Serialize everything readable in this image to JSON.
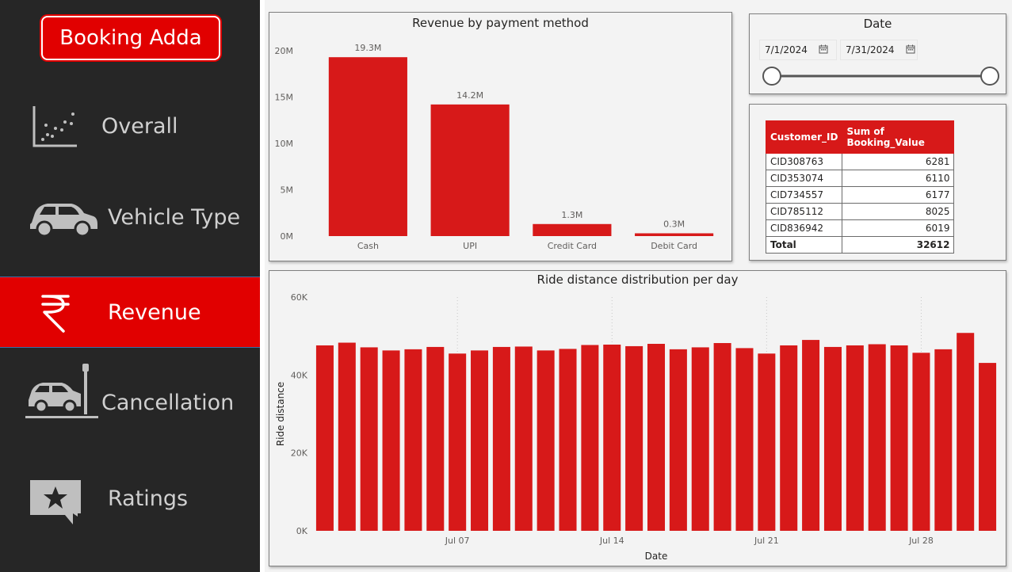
{
  "app": {
    "logo": "Booking Adda"
  },
  "nav": [
    {
      "label": "Overall",
      "icon": "scatter-chart-icon"
    },
    {
      "label": "Vehicle Type",
      "icon": "car-icon"
    },
    {
      "label": "Revenue",
      "icon": "rupee-icon",
      "active": true
    },
    {
      "label": "Cancellation",
      "icon": "crashed-car-icon"
    },
    {
      "label": "Ratings",
      "icon": "star-chat-icon"
    }
  ],
  "date_slicer": {
    "title": "Date",
    "start": "7/1/2024",
    "end": "7/31/2024",
    "range_fraction": [
      0,
      1
    ]
  },
  "customer_table": {
    "headers": [
      "Customer_ID",
      "Sum of Booking_Value"
    ],
    "rows": [
      [
        "CID308763",
        "6281"
      ],
      [
        "CID353074",
        "6110"
      ],
      [
        "CID734557",
        "6177"
      ],
      [
        "CID785112",
        "8025"
      ],
      [
        "CID836942",
        "6019"
      ]
    ],
    "total_label": "Total",
    "total_value": "32612"
  },
  "colors": {
    "accent": "#e10000",
    "bar": "#d71919",
    "sidebar": "#262626"
  },
  "chart_data": [
    {
      "type": "bar",
      "title": "Revenue by payment method",
      "categories": [
        "Cash",
        "UPI",
        "Credit Card",
        "Debit Card"
      ],
      "values": [
        19.3,
        14.2,
        1.3,
        0.3
      ],
      "data_labels": [
        "19.3M",
        "14.2M",
        "1.3M",
        "0.3M"
      ],
      "yticks": [
        "0M",
        "5M",
        "10M",
        "15M",
        "20M"
      ],
      "ylim": [
        0,
        20
      ],
      "grid": false
    },
    {
      "type": "bar",
      "title": "Ride distance distribution per day",
      "xlabel": "Date",
      "ylabel": "Ride distance",
      "x": [
        "Jul 01",
        "Jul 02",
        "Jul 03",
        "Jul 04",
        "Jul 05",
        "Jul 06",
        "Jul 07",
        "Jul 08",
        "Jul 09",
        "Jul 10",
        "Jul 11",
        "Jul 12",
        "Jul 13",
        "Jul 14",
        "Jul 15",
        "Jul 16",
        "Jul 17",
        "Jul 18",
        "Jul 19",
        "Jul 20",
        "Jul 21",
        "Jul 22",
        "Jul 23",
        "Jul 24",
        "Jul 25",
        "Jul 26",
        "Jul 27",
        "Jul 28",
        "Jul 29",
        "Jul 30",
        "Jul 31"
      ],
      "values": [
        47600,
        48300,
        47100,
        46300,
        46600,
        47200,
        45500,
        46300,
        47200,
        47300,
        46300,
        46700,
        47700,
        47800,
        47400,
        48000,
        46600,
        47100,
        48200,
        46900,
        45500,
        47600,
        49000,
        47200,
        47600,
        47900,
        47600,
        45700,
        46600,
        50800,
        43100
      ],
      "xtick_labels": [
        "Jul 07",
        "Jul 14",
        "Jul 21",
        "Jul 28"
      ],
      "yticks": [
        "0K",
        "20K",
        "40K",
        "60K"
      ],
      "ylim": [
        0,
        60000
      ],
      "grid": "vertical-dotted"
    }
  ]
}
